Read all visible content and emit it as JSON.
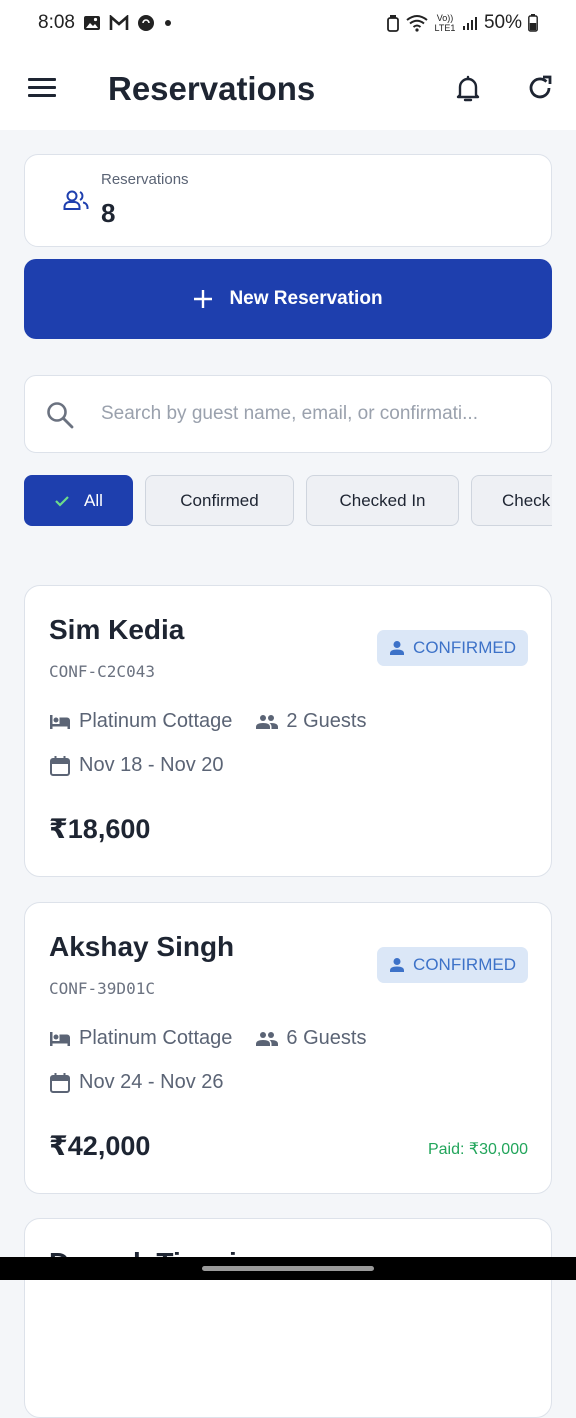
{
  "status_bar": {
    "time": "8:08",
    "battery": "50%",
    "volte": "Vo)) LTE1"
  },
  "header": {
    "title": "Reservations"
  },
  "summary": {
    "label": "Reservations",
    "count": "8"
  },
  "new_button": {
    "label": "New Reservation"
  },
  "search": {
    "placeholder": "Search by guest name, email, or confirmati..."
  },
  "filters": [
    {
      "label": "All",
      "active": true
    },
    {
      "label": "Confirmed",
      "active": false
    },
    {
      "label": "Checked In",
      "active": false
    },
    {
      "label": "Check",
      "active": false
    }
  ],
  "reservations": [
    {
      "guest": "Sim Kedia",
      "code": "CONF-C2C043",
      "status": "CONFIRMED",
      "room": "Platinum Cottage",
      "guests": "2 Guests",
      "dates": "Nov 18 - Nov 20",
      "amount": "₹18,600",
      "paid": ""
    },
    {
      "guest": "Akshay Singh",
      "code": "CONF-39D01C",
      "status": "CONFIRMED",
      "room": "Platinum Cottage",
      "guests": "6 Guests",
      "dates": "Nov 24 - Nov 26",
      "amount": "₹42,000",
      "paid": "Paid: ₹30,000"
    }
  ],
  "partial_card": {
    "guest": "Deepak Tiwari"
  },
  "colors": {
    "primary": "#1e3fae",
    "badge_bg": "#dbe7f7",
    "badge_text": "#3d72c8",
    "paid_text": "#22a55b"
  }
}
